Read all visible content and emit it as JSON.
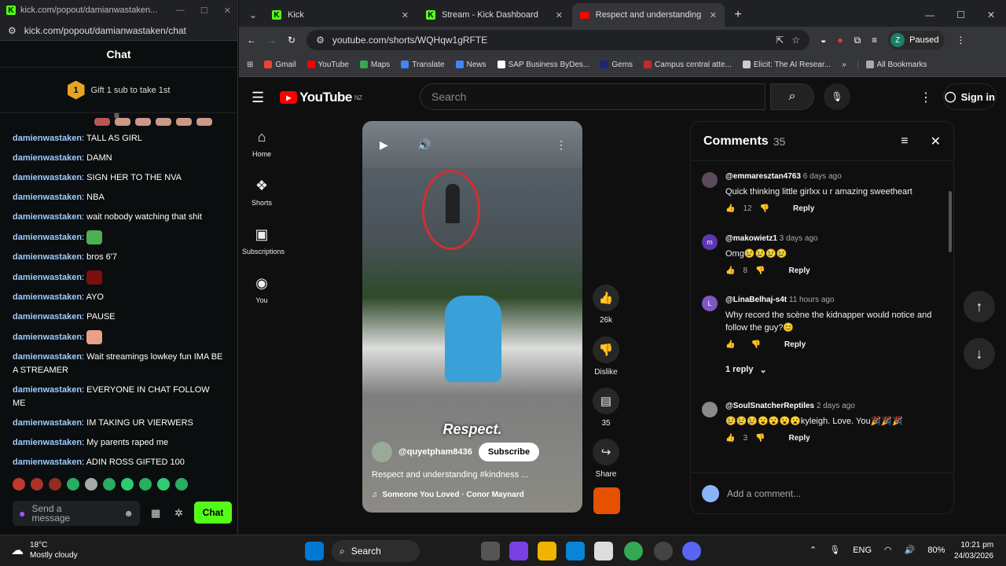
{
  "kick": {
    "tab_title": "kick.com/popout/damianwastaken...",
    "url": "kick.com/popout/damianwastaken/chat",
    "chat_title": "Chat",
    "gift_badge": "1",
    "gift_text": "Gift 1 sub to take 1st",
    "messages": [
      {
        "user": "damienwastaken",
        "text": "TALL AS GIRL"
      },
      {
        "user": "damienwastaken",
        "text": "DAMN"
      },
      {
        "user": "damienwastaken",
        "text": "SIGN HER TO THE NVA"
      },
      {
        "user": "damienwastaken",
        "text": "NBA"
      },
      {
        "user": "damienwastaken",
        "text": "wait nobody watching that shit"
      },
      {
        "user": "damienwastaken",
        "text": ""
      },
      {
        "user": "damienwastaken",
        "text": "bros 6'7"
      },
      {
        "user": "damienwastaken",
        "text": ""
      },
      {
        "user": "damienwastaken",
        "text": "AYO"
      },
      {
        "user": "damienwastaken",
        "text": "PAUSE"
      },
      {
        "user": "damienwastaken",
        "text": ""
      },
      {
        "user": "damienwastaken",
        "text": "Wait streamings lowkey fun IMA BE A STREAMER"
      },
      {
        "user": "damienwastaken",
        "text": "EVERYONE IN CHAT FOLLOW ME"
      },
      {
        "user": "damienwastaken",
        "text": "IM TAKING UR VIERWERS"
      },
      {
        "user": "damienwastaken",
        "text": "My parents raped me"
      },
      {
        "user": "damienwastaken",
        "text": "ADIN ROSS GIFTED 100"
      }
    ],
    "composer_placeholder": "Send a message",
    "chat_button": "Chat"
  },
  "browser": {
    "tabs": [
      {
        "title": "Kick"
      },
      {
        "title": "Stream - Kick Dashboard"
      },
      {
        "title": "Respect and understanding #ki"
      }
    ],
    "url": "youtube.com/shorts/WQHqw1gRFTE",
    "profile_initial": "Z",
    "profile_status": "Paused",
    "bookmarks": [
      "Gmail",
      "YouTube",
      "Maps",
      "Translate",
      "News",
      "SAP Business ByDes...",
      "Gems",
      "Campus central atte...",
      "Elicit: The AI Resear..."
    ],
    "all_bookmarks": "All Bookmarks"
  },
  "youtube": {
    "logo": "YouTube",
    "region": "NZ",
    "search_placeholder": "Search",
    "sign_in": "Sign in",
    "rail": [
      {
        "icon": "home-icon",
        "label": "Home"
      },
      {
        "icon": "shorts-icon",
        "label": "Shorts"
      },
      {
        "icon": "subscriptions-icon",
        "label": "Subscriptions"
      },
      {
        "icon": "you-icon",
        "label": "You"
      }
    ],
    "video": {
      "caption": "Respect.",
      "channel": "@quyetpham8436",
      "subscribe": "Subscribe",
      "title": "Respect and understanding #kindness ...",
      "music": "Someone You Loved · Conor Maynard"
    },
    "actions": {
      "likes": "26k",
      "dislike": "Dislike",
      "comments": "35",
      "share": "Share"
    },
    "comments": {
      "title": "Comments",
      "count": "35",
      "items": [
        {
          "avatar": "",
          "user": "@emmaresztan4763",
          "time": "6 days ago",
          "text": "Quick thinking little girlxx u r amazing sweetheart",
          "likes": "12",
          "reply": "Reply",
          "avatar_color": "#5a4a5a"
        },
        {
          "avatar": "m",
          "user": "@makowietz1",
          "time": "3 days ago",
          "text": "Omg😢😢😢😢",
          "likes": "8",
          "reply": "Reply",
          "avatar_color": "#5e35b1"
        },
        {
          "avatar": "L",
          "user": "@LinaBelhaj-s4t",
          "time": "11 hours ago",
          "text": "Why record the scène the kidnapper would notice and follow the guy?😊",
          "likes": "",
          "reply": "Reply",
          "avatar_color": "#7e57c2"
        },
        {
          "avatar": "",
          "user": "@SoulSnatcherReptiles",
          "time": "2 days ago",
          "text": "😢😢😢😮😮😮😮kyleigh.   Love.  You🎉🎉🎉",
          "likes": "3",
          "reply": "Reply",
          "avatar_color": "#8a8a8a"
        }
      ],
      "replies_toggle": "1 reply",
      "add_placeholder": "Add a comment..."
    }
  },
  "taskbar": {
    "weather_temp": "18°C",
    "weather_desc": "Mostly cloudy",
    "search": "Search",
    "lang": "ENG",
    "battery": "80%",
    "time": "10:21 pm",
    "date": "24/03/2026"
  }
}
